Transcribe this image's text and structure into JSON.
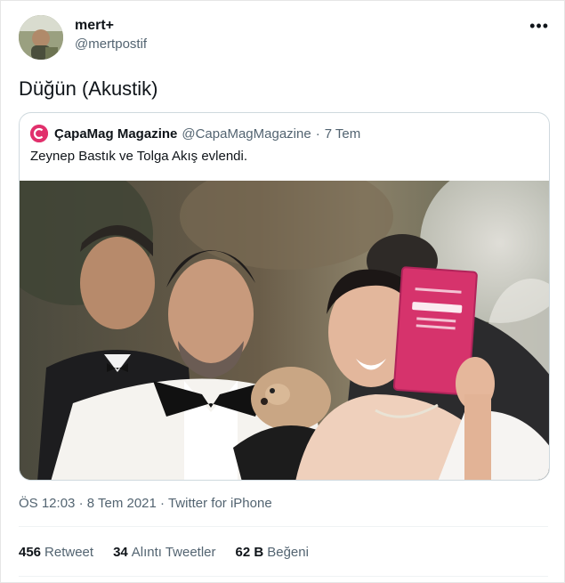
{
  "author": {
    "display_name": "mert+",
    "handle": "@mertpostif",
    "more_icon": "ellipsis-icon"
  },
  "tweet": {
    "text": "Düğün (Akustik)"
  },
  "quoted_tweet": {
    "display_name": "ÇapaMag Magazine",
    "handle": "@CapaMagMagazine",
    "separator": "·",
    "date": "7 Tem",
    "text": "Zeynep Bastık ve Tolga Akış evlendi."
  },
  "meta": {
    "time": "ÖS 12:03",
    "separator": "·",
    "date": "8 Tem 2021",
    "source": "Twitter for iPhone"
  },
  "stats": [
    {
      "count": "456",
      "label": "Retweet"
    },
    {
      "count": "34",
      "label": "Alıntı Tweetler"
    },
    {
      "count": "62 B",
      "label": "Beğeni"
    }
  ],
  "colors": {
    "text_primary": "#0f1419",
    "text_secondary": "#536471",
    "border": "#cfd9de",
    "brand_pink": "#e1306c"
  }
}
